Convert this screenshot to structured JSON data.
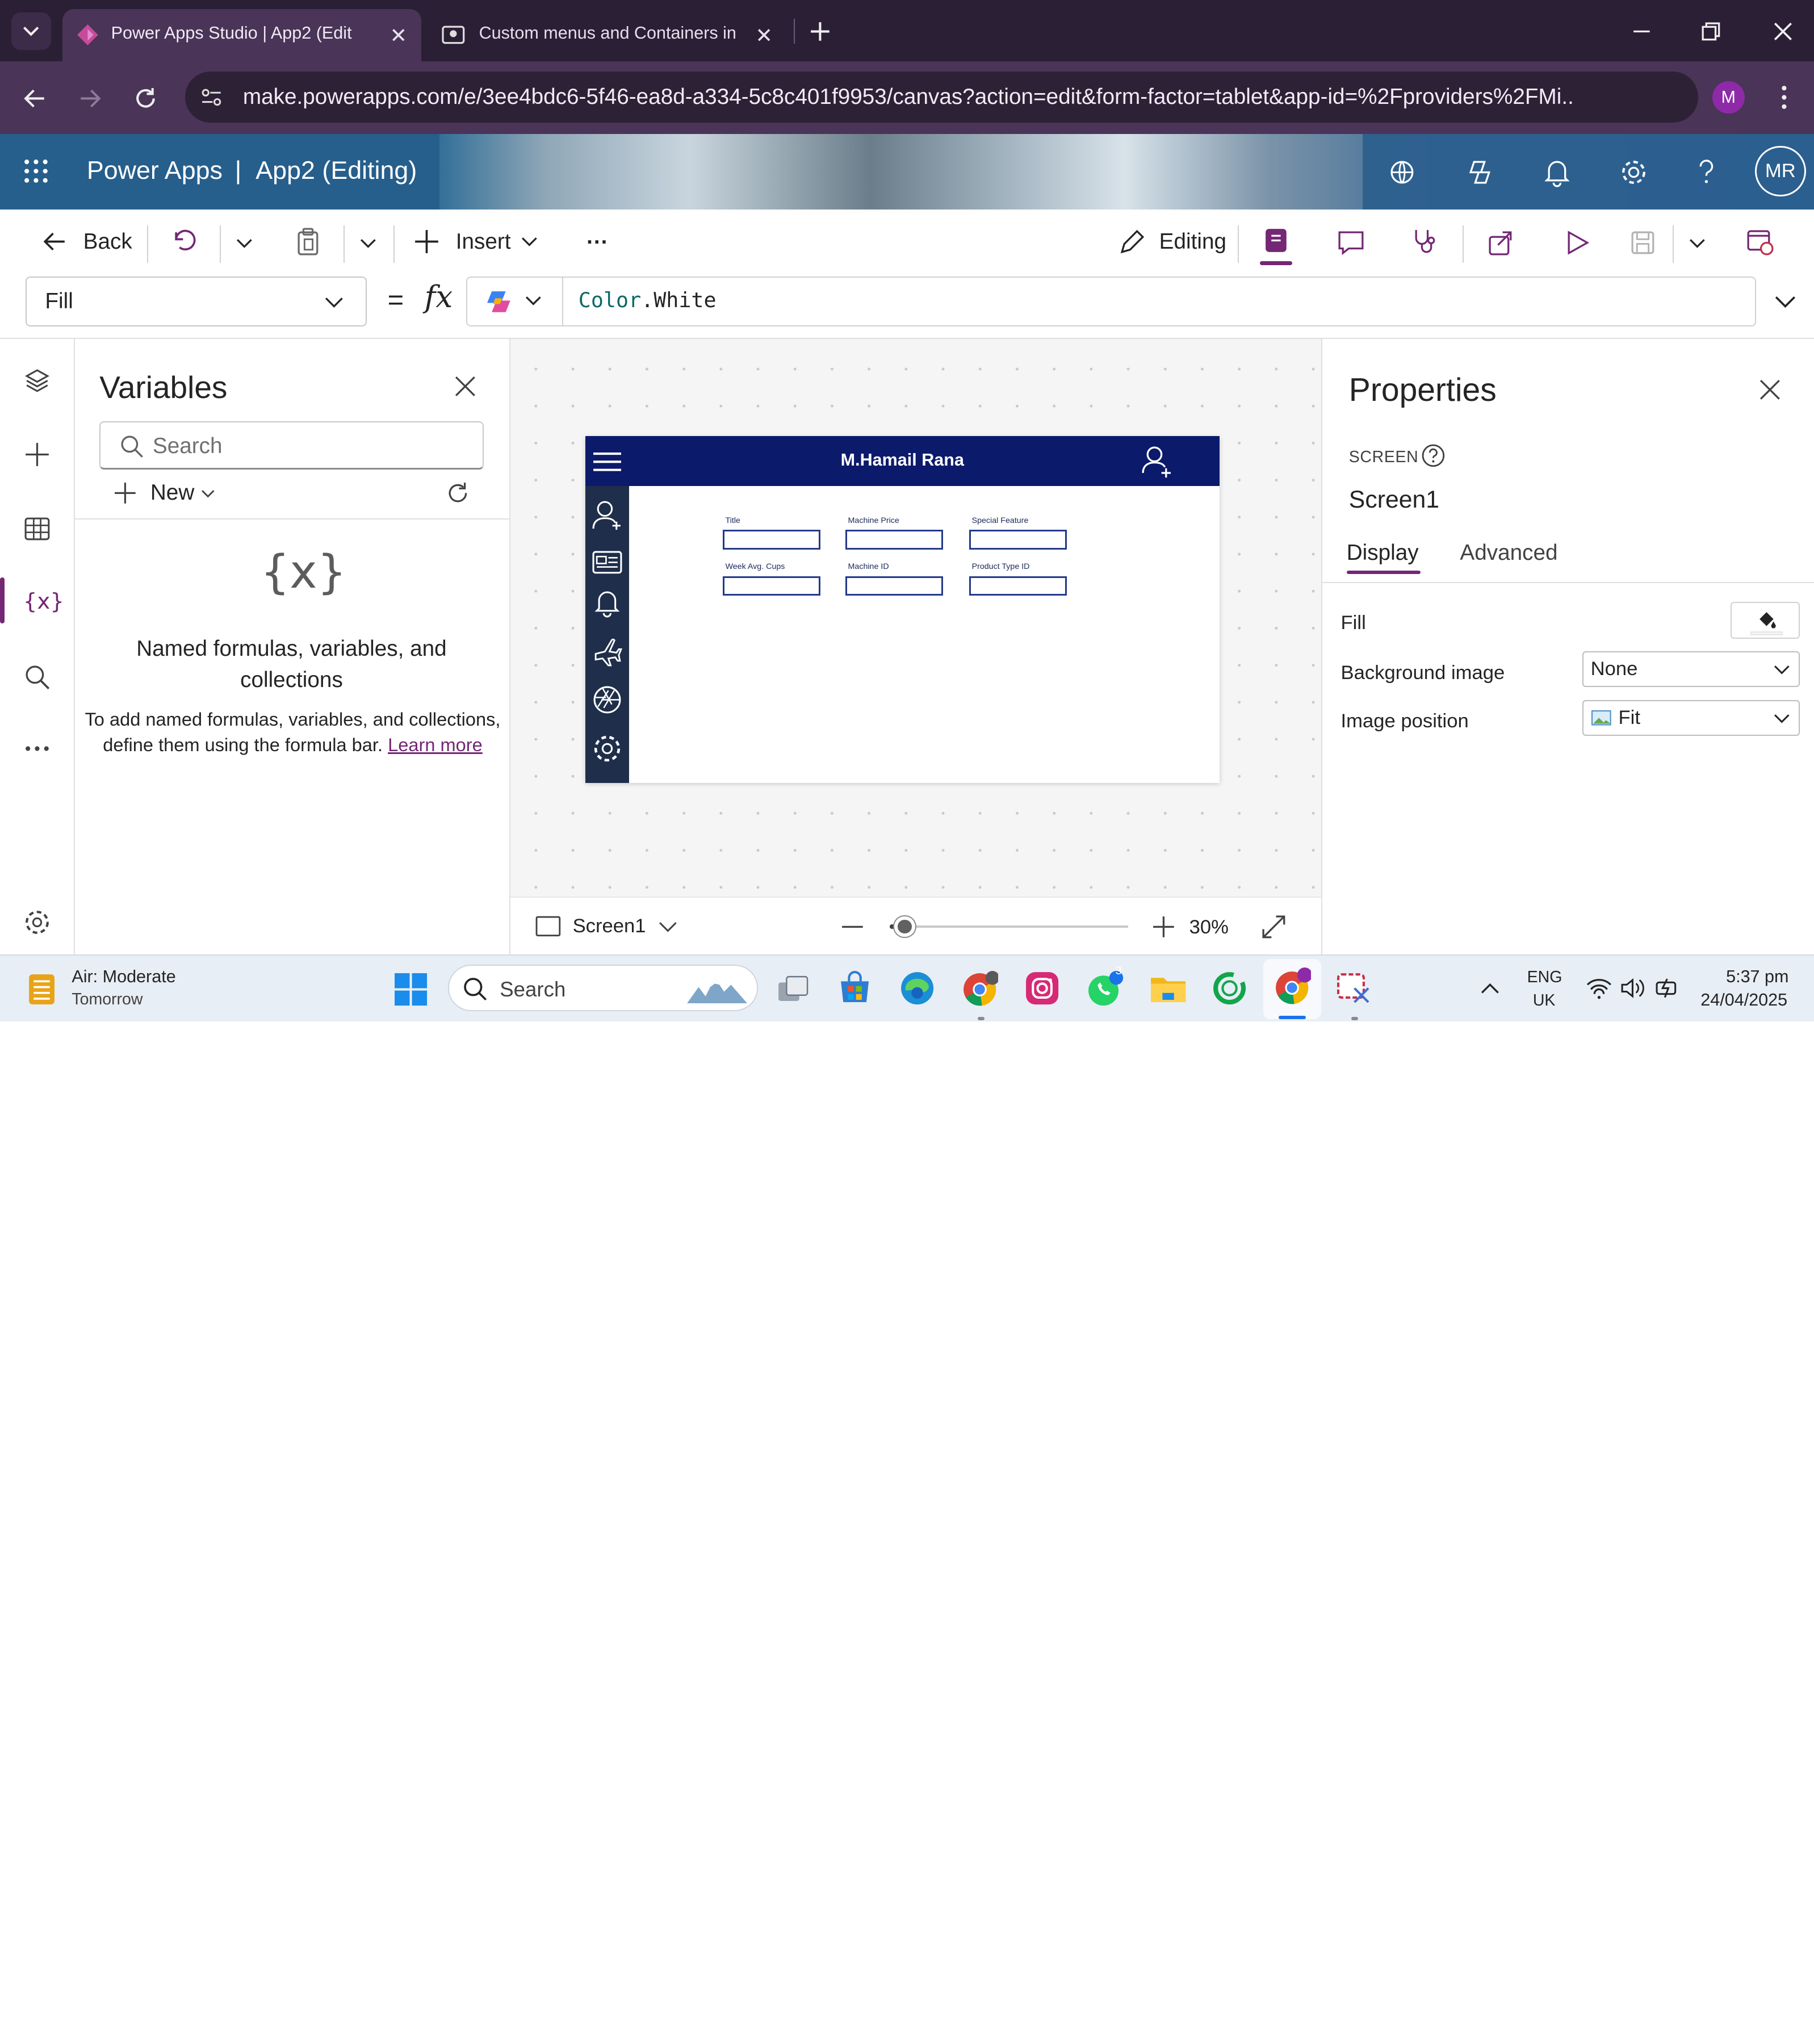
{
  "browser": {
    "tabs": [
      {
        "title": "Power Apps Studio  | App2 (Edit",
        "active": true
      },
      {
        "title": "Custom menus and Containers in",
        "active": false
      }
    ],
    "url": "make.powerapps.com/e/3ee4bdc6-5f46-ea8d-a334-5c8c401f9953/canvas?action=edit&form-factor=tablet&app-id=%2Fproviders%2FMi...",
    "profile_initial": "M"
  },
  "header": {
    "app_name": "Power Apps",
    "separator": "|",
    "doc_title": "App2 (Editing)",
    "user_initials": "MR"
  },
  "toolbar": {
    "back_label": "Back",
    "insert_label": "Insert",
    "more_label": "...",
    "editing_label": "Editing"
  },
  "formula_bar": {
    "property": "Fill",
    "equals": "=",
    "fx": "fx",
    "formula_obj": "Color",
    "formula_member": ".White"
  },
  "variables_pane": {
    "title": "Variables",
    "search_placeholder": "Search",
    "new_label": "New",
    "empty_icon_text": "{x}",
    "empty_heading": "Named formulas, variables, and collections",
    "empty_body": "To add named formulas, variables, and collections, define them using the formula bar.",
    "learn_more": "Learn more"
  },
  "app_screen": {
    "title": "M.Hamail Rana",
    "fields": [
      "Title",
      "Machine Price",
      "Special Feature",
      "Week Avg. Cups",
      "Machine ID",
      "Product Type ID"
    ]
  },
  "canvas_footer": {
    "screen_name": "Screen1",
    "zoom": "30%",
    "zoom_level": 0.3
  },
  "properties_pane": {
    "title": "Properties",
    "type_label": "SCREEN",
    "screen_name": "Screen1",
    "tabs": [
      "Display",
      "Advanced"
    ],
    "rows": [
      {
        "label": "Fill"
      },
      {
        "label": "Background image",
        "value": "None"
      },
      {
        "label": "Image position",
        "value": "Fit"
      }
    ]
  },
  "taskbar": {
    "weather_title": "Air: Moderate",
    "weather_sub": "Tomorrow",
    "search_label": "Search",
    "whatsapp_badge": "3",
    "lang_top": "ENG",
    "lang_bottom": "UK",
    "time": "5:37 pm",
    "date": "24/04/2025"
  },
  "colors": {
    "brand_purple": "#742774",
    "app_header": "#0b1a6b",
    "app_sidebar": "#1f2e4a",
    "chrome_dark": "#2b1f36"
  }
}
